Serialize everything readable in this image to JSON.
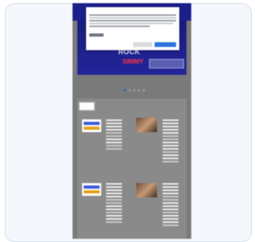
{
  "colors": {
    "card_background": "#f4f7fc",
    "site_header": "#1c1e8a",
    "hero_background": "#23259a",
    "accent_red": "#ff3344",
    "primary_button": "#2b73d9",
    "page_background": "#7a7a7a"
  },
  "hero": {
    "title_line1": "ROCK",
    "title_line2": "SIMMY"
  },
  "carousel": {
    "slide_count": 5,
    "active_index": 0
  }
}
